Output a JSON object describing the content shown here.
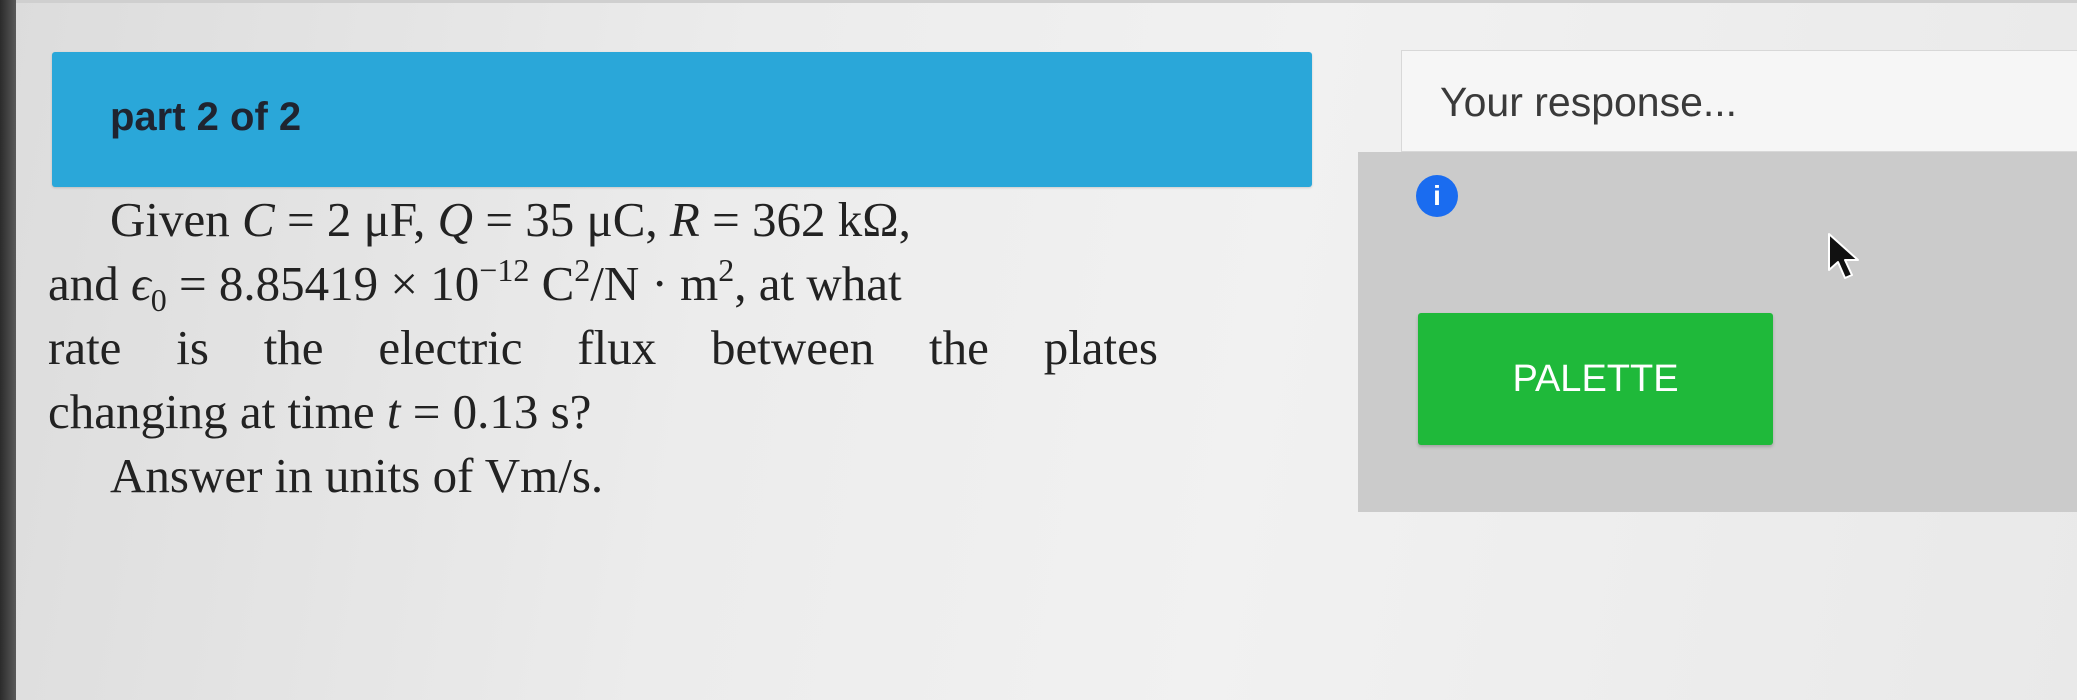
{
  "question": {
    "part_label": "part 2 of 2",
    "given": "Given",
    "C_var": "C",
    "C_value": " = 2 μF, ",
    "Q_var": "Q",
    "Q_value": " = 35 μC, ",
    "R_var": "R",
    "R_value": " = 362 kΩ,",
    "and": "and ",
    "eps_var": "ϵ",
    "eps_sub": "0",
    "eps_value": " = 8.85419 × 10",
    "eps_exp": "−12",
    "eps_unit_c": " C",
    "eps_unit_c_exp": "2",
    "eps_unit_rest": "/N · m",
    "eps_unit_m_exp": "2",
    "at_what": ", at what",
    "line3_words": [
      "rate",
      "is",
      "the",
      "electric",
      "flux",
      "between",
      "the",
      "plates"
    ],
    "line4_prefix": "changing at time ",
    "t_var": "t",
    "t_value": " = 0.13 s?",
    "answer_prefix": "Answer in units of ",
    "answer_units": "Vm/s."
  },
  "response": {
    "placeholder": "Your response...",
    "info_icon": "i",
    "palette_label": "PALETTE"
  },
  "colors": {
    "header_blue": "#2aa7d9",
    "palette_green": "#1fb93a",
    "info_blue": "#1a6cf0"
  },
  "icons": [
    "info-icon",
    "mouse-cursor-icon"
  ]
}
